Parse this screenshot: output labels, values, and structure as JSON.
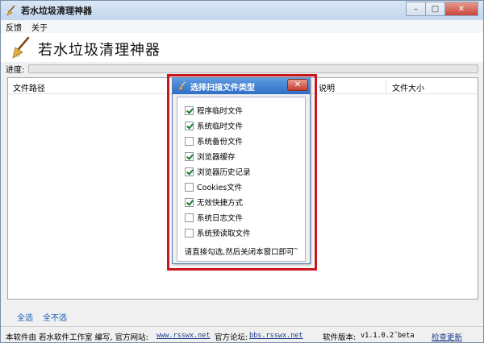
{
  "window": {
    "title": "若水垃圾清理神器",
    "controls": {
      "minimize": "–",
      "maximize": "□",
      "close": "✕"
    }
  },
  "menu": {
    "items": [
      "反馈",
      "关于"
    ]
  },
  "header": {
    "app_name": "若水垃圾清理神器",
    "icon": "broom-icon"
  },
  "progress": {
    "label": "进度:",
    "value": 0
  },
  "file_list": {
    "columns": [
      "文件路径",
      "说明",
      "文件大小"
    ],
    "rows": []
  },
  "selection": {
    "select_all": "全选",
    "select_none": "全不选"
  },
  "status_bar": {
    "author_text": "本软件由 若水软件工作室 编写, 官方网站:",
    "website": "www.rsswx.net",
    "forum_label": "官方论坛:",
    "forum": "bbs.rsswx.net",
    "version_label": "软件版本:",
    "version": "v1.1.0.2˜beta",
    "check_update": "检查更新"
  },
  "dialog": {
    "title": "选择扫描文件类型",
    "close": "✕",
    "options": [
      {
        "label": "程序临时文件",
        "checked": true
      },
      {
        "label": "系统临时文件",
        "checked": true
      },
      {
        "label": "系统备份文件",
        "checked": false
      },
      {
        "label": "浏览器缓存",
        "checked": true
      },
      {
        "label": "浏览器历史记录",
        "checked": true
      },
      {
        "label": "Cookies文件",
        "checked": false
      },
      {
        "label": "无效快捷方式",
        "checked": true
      },
      {
        "label": "系统日志文件",
        "checked": false
      },
      {
        "label": "系统预读取文件",
        "checked": false
      }
    ],
    "hint": "请直接勾选,然后关闭本窗口即可˜"
  },
  "colors": {
    "highlight_frame": "#c9161d",
    "dialog_title": "#2f6fc6",
    "link": "#1a5bb5"
  }
}
